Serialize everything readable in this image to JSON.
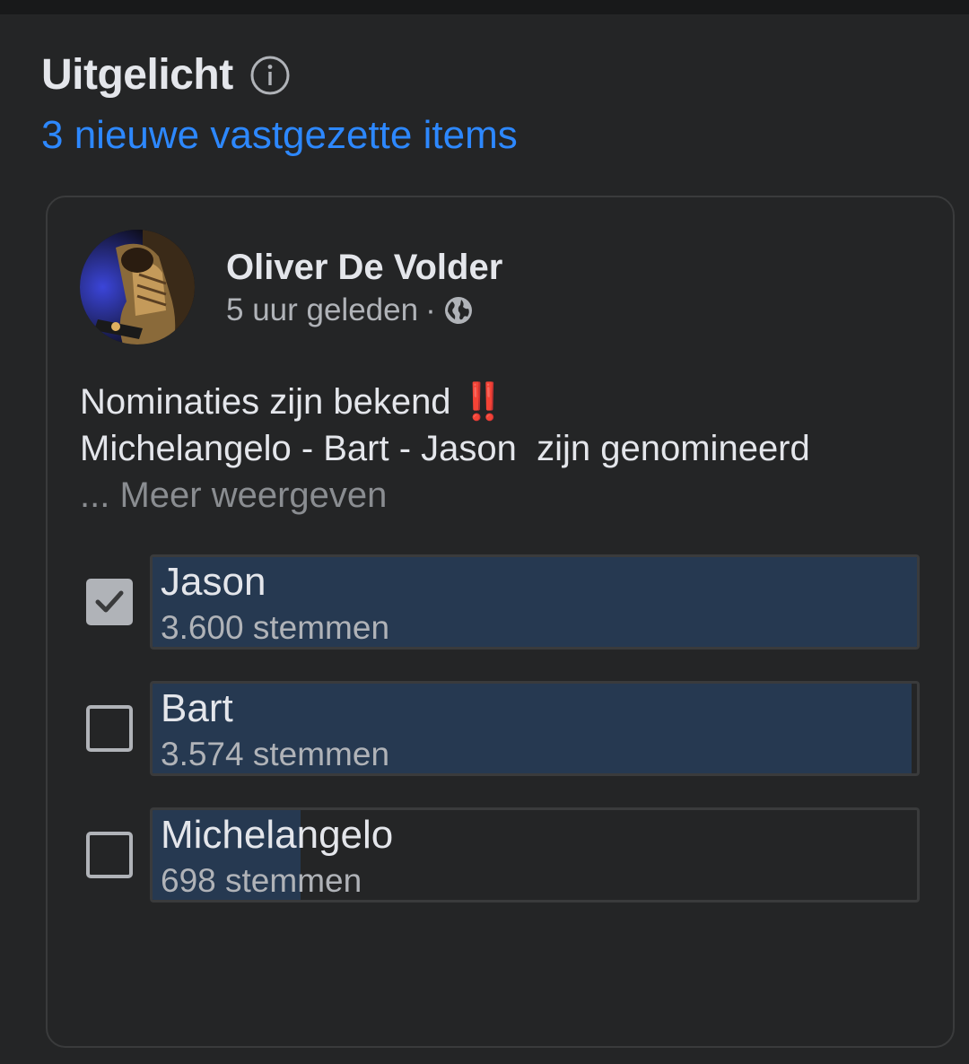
{
  "header": {
    "title": "Uitgelicht",
    "info_icon": "info-icon",
    "pinned_link": "3 nieuwe vastgezette items"
  },
  "post": {
    "author": "Oliver De Volder",
    "time": "5 uur geleden",
    "separator": "·",
    "privacy_icon": "globe-icon",
    "text_line1": "Nominaties zijn bekend ",
    "emoji": "‼️",
    "text_line2": "Michelangelo - Bart - Jason  zijn genomineerd",
    "more": "... Meer weergeven"
  },
  "poll": {
    "options": [
      {
        "label": "Jason",
        "votes": "3.600 stemmen",
        "checked": true,
        "share": 1.0
      },
      {
        "label": "Bart",
        "votes": "3.574 stemmen",
        "checked": false,
        "share": 0.993
      },
      {
        "label": "Michelangelo",
        "votes": "698 stemmen",
        "checked": false,
        "share": 0.194
      }
    ]
  },
  "colors": {
    "background": "#242526",
    "text": "#e4e6eb",
    "secondary_text": "#b0b3b8",
    "link": "#2d88ff",
    "poll_fill": "#263951",
    "exclamation": "#f02849"
  }
}
